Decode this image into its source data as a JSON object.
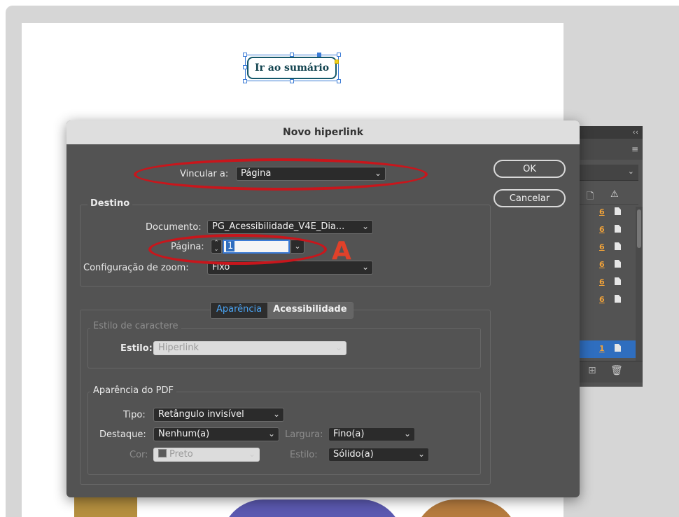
{
  "document": {
    "button_text": "Ir ao sumário"
  },
  "links_panel": {
    "collapse_icon": "double-chevron-left-icon",
    "menu_icon": "hamburger-icon",
    "rows": [
      {
        "page": "6",
        "selected": false
      },
      {
        "page": "6",
        "selected": false
      },
      {
        "page": "6",
        "selected": false
      },
      {
        "page": "6",
        "selected": false
      },
      {
        "page": "6",
        "selected": false
      },
      {
        "page": "6",
        "selected": false
      },
      {
        "page": "1",
        "selected": true
      }
    ]
  },
  "dialog": {
    "title": "Novo hiperlink",
    "link_to_label": "Vincular a:",
    "link_to_value": "Página",
    "ok_label": "OK",
    "cancel_label": "Cancelar",
    "destination": {
      "group_label": "Destino",
      "document_label": "Documento:",
      "document_value": "PG_Acessibilidade_V4E_Dia...",
      "page_label": "Página:",
      "page_value": "1",
      "zoom_label": "Configuração de zoom:",
      "zoom_value": "Fixo"
    },
    "tabs": {
      "appearance": "Aparência",
      "accessibility": "Acessibilidade"
    },
    "char_style": {
      "group_label": "Estilo de caractere",
      "style_label": "Estilo:",
      "style_value": "Hiperlink"
    },
    "pdf_appearance": {
      "group_label": "Aparência do PDF",
      "type_label": "Tipo:",
      "type_value": "Retângulo invisível",
      "highlight_label": "Destaque:",
      "highlight_value": "Nenhum(a)",
      "width_label": "Largura:",
      "width_value": "Fino(a)",
      "color_label": "Cor:",
      "color_value": "Preto",
      "stroke_style_label": "Estilo:",
      "stroke_style_value": "Sólido(a)"
    }
  },
  "annotation": {
    "letter": "A",
    "color": "#c8161c"
  }
}
